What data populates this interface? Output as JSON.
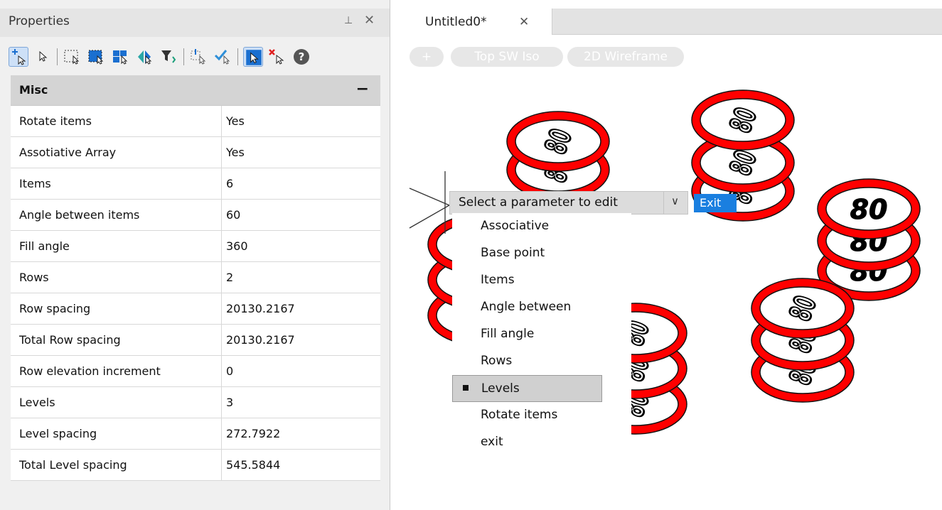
{
  "properties_panel": {
    "title": "Properties",
    "pin_icon": "pin-icon",
    "close_label": "✕",
    "toolbar": [
      "add-selection-icon",
      "select-icon",
      "select-window-icon",
      "select-crossing-icon",
      "quick-select-icon",
      "filter-icon",
      "match-properties-icon",
      "check-icon",
      "pickadd-icon",
      "remove-icon",
      "help-icon"
    ],
    "section": {
      "label": "Misc",
      "collapse_label": "−"
    },
    "rows": [
      {
        "name": "Rotate items",
        "value": "Yes"
      },
      {
        "name": "Assotiative Array",
        "value": "Yes"
      },
      {
        "name": "Items",
        "value": "6"
      },
      {
        "name": "Angle between items",
        "value": "60"
      },
      {
        "name": "Fill angle",
        "value": "360"
      },
      {
        "name": "Rows",
        "value": "2"
      },
      {
        "name": "Row spacing",
        "value": "20130.2167"
      },
      {
        "name": "Total Row spacing",
        "value": "20130.2167"
      },
      {
        "name": "Row elevation increment",
        "value": "0"
      },
      {
        "name": "Levels",
        "value": "3"
      },
      {
        "name": "Level spacing",
        "value": "272.7922"
      },
      {
        "name": "Total Level spacing",
        "value": "545.5844"
      }
    ]
  },
  "document_tab": {
    "label": "Untitled0*",
    "close_label": "✕"
  },
  "viewport_controls": {
    "add": "+",
    "view": "Top SW Iso",
    "style": "2D Wireframe"
  },
  "parameter_prompt": {
    "label": "Select a parameter to edit",
    "dropdown": "∨",
    "exit_button": "Exit"
  },
  "parameter_menu": {
    "items": [
      "Associative",
      "Base point",
      "Items",
      "Angle between",
      "Fill angle",
      "Rows",
      "Levels",
      "Rotate items",
      "exit"
    ],
    "selected": "Levels"
  },
  "signs": {
    "number": "80",
    "ring_color": "#ff0000"
  }
}
